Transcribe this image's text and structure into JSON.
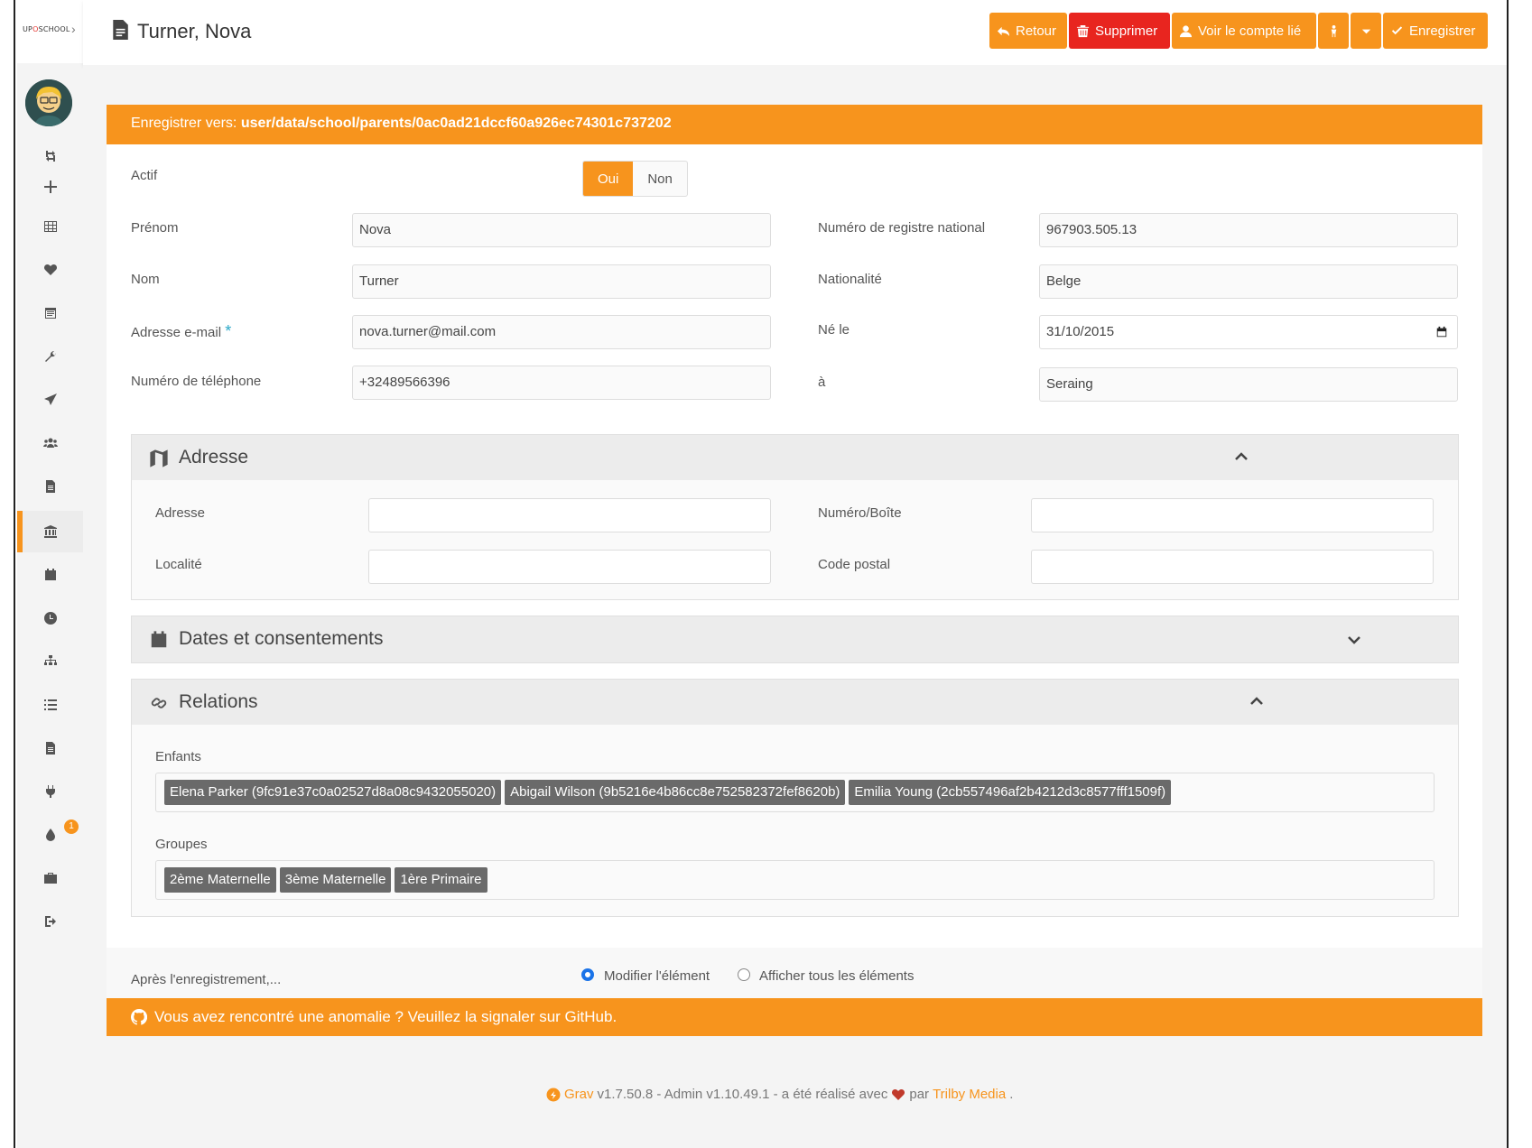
{
  "app": {
    "logo_text_pre": "UP",
    "logo_text_o": "O",
    "logo_text_post": "SCHOOL",
    "page_title": "Turner, Nova"
  },
  "toolbar": {
    "back_label": "Retour",
    "delete_label": "Supprimer",
    "linked_account_label": "Voir le compte lié",
    "save_label": "Enregistrer"
  },
  "save_location": {
    "prefix": "Enregistrer vers:",
    "path": "user/data/school/parents/0ac0ad21dccf60a926ec74301c737202"
  },
  "form": {
    "active_label": "Actif",
    "active_yes": "Oui",
    "active_no": "Non",
    "first_name_label": "Prénom",
    "first_name_value": "Nova",
    "last_name_label": "Nom",
    "last_name_value": "Turner",
    "email_label": "Adresse e-mail",
    "email_required": "*",
    "email_value": "nova.turner@mail.com",
    "phone_label": "Numéro de téléphone",
    "phone_value": "+32489566396",
    "national_id_label": "Numéro de registre national",
    "national_id_value": "967903.505.13",
    "nationality_label": "Nationalité",
    "nationality_value": "Belge",
    "birth_date_label": "Né le",
    "birth_date_value": "31/10/2015",
    "birth_place_label": "à",
    "birth_place_value": "Seraing"
  },
  "address_panel": {
    "title": "Adresse",
    "address_label": "Adresse",
    "address_value": "",
    "number_label": "Numéro/Boîte",
    "number_value": "",
    "locality_label": "Localité",
    "locality_value": "",
    "postal_label": "Code postal",
    "postal_value": ""
  },
  "dates_panel": {
    "title": "Dates et consentements"
  },
  "relations_panel": {
    "title": "Relations",
    "children_label": "Enfants",
    "children": [
      "Elena Parker (9fc91e37c0a02527d8a08c9432055020)",
      "Abigail Wilson (9b5216e4b86cc8e752582372fef8620b)",
      "Emilia Young (2cb557496af2b4212d3c8577fff1509f)"
    ],
    "groups_label": "Groupes",
    "groups": [
      "2ème Maternelle",
      "3ème Maternelle",
      "1ère Primaire"
    ]
  },
  "after_save": {
    "label": "Après l'enregistrement,...",
    "option_edit": "Modifier l'élément",
    "option_list": "Afficher tous les éléments"
  },
  "github_banner": {
    "text": "Vous avez rencontré une anomalie ? Veuillez la signaler sur GitHub."
  },
  "footer": {
    "grav": "Grav",
    "version_text": "v1.7.50.8 - Admin v1.10.49.1 - a été réalisé avec",
    "by": "par",
    "trilby": "Trilby Media",
    "period": "."
  },
  "sidebar": {
    "notification_count": "1"
  },
  "colors": {
    "accent": "#f7941d",
    "danger": "#e8251f",
    "tag": "#6a6a6a"
  }
}
